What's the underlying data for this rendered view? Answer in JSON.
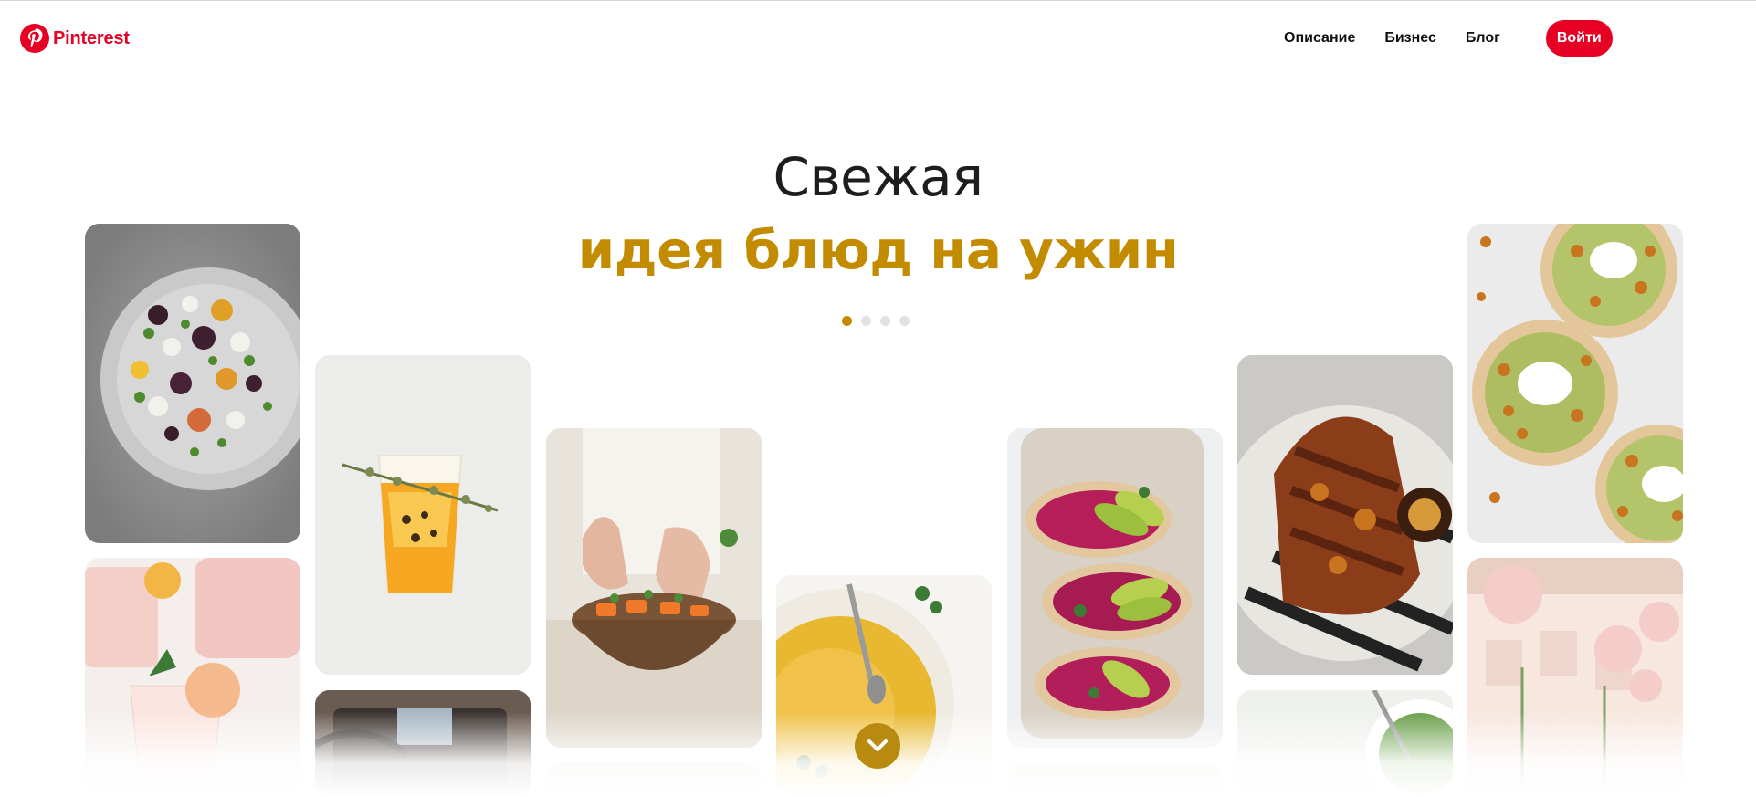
{
  "brand": {
    "name": "Pinterest",
    "color": "#e60023"
  },
  "nav": {
    "links": [
      "Описание",
      "Бизнес",
      "Блог"
    ],
    "login_label": "Войти"
  },
  "hero": {
    "line1": "Свежая",
    "line2": "идея блюд на ужин",
    "accent_color": "#c28b00"
  },
  "carousel": {
    "total_dots": 4,
    "active_index": 0
  },
  "pins": [
    {
      "icon": "salad-plate-image"
    },
    {
      "icon": "pink-lemonade-image"
    },
    {
      "icon": "orange-drink-image"
    },
    {
      "icon": "kitchen-pan-image"
    },
    {
      "icon": "hands-salad-bowl-image"
    },
    {
      "icon": "hummus-bowl-image"
    },
    {
      "icon": "beet-avocado-toast-image"
    },
    {
      "icon": "grilled-chicken-image"
    },
    {
      "icon": "greens-bowl-image"
    },
    {
      "icon": "chickpea-flatbread-image"
    },
    {
      "icon": "party-balloons-image"
    }
  ],
  "scroll_button": {
    "icon": "chevron-down-icon"
  }
}
